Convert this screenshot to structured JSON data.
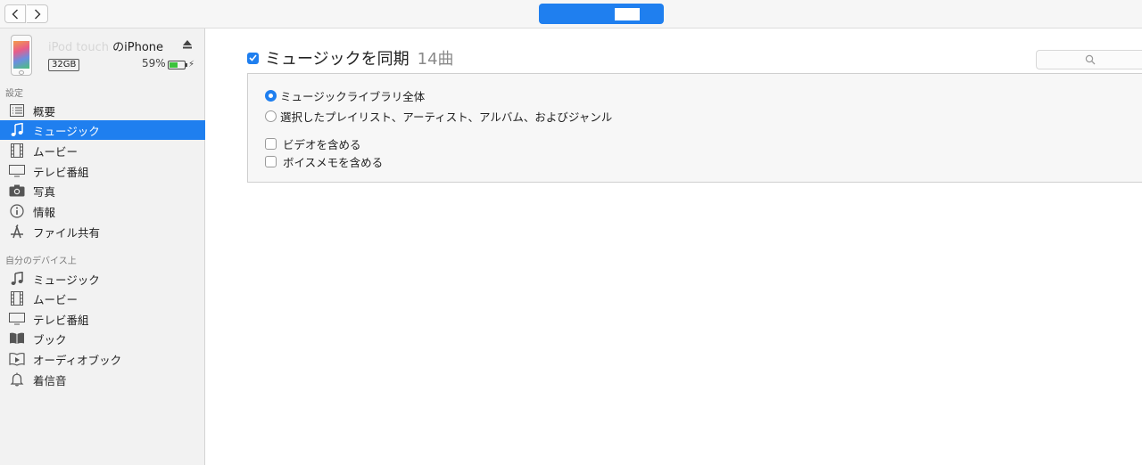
{
  "toolbar": {
    "back_icon": "chevron-left-icon",
    "forward_icon": "chevron-right-icon"
  },
  "device": {
    "name_hidden": "iPod touch ",
    "name_visible": "のiPhone",
    "capacity": "32GB",
    "battery_percent": "59%",
    "battery_level": 0.59
  },
  "sidebar": {
    "settings_title": "設定",
    "settings_items": [
      {
        "label": "概要",
        "icon": "list-icon"
      },
      {
        "label": "ミュージック",
        "icon": "music-note-icon",
        "selected": true
      },
      {
        "label": "ムービー",
        "icon": "film-icon"
      },
      {
        "label": "テレビ番組",
        "icon": "tv-icon"
      },
      {
        "label": "写真",
        "icon": "camera-icon"
      },
      {
        "label": "情報",
        "icon": "info-icon"
      },
      {
        "label": "ファイル共有",
        "icon": "apps-icon"
      }
    ],
    "ondevice_title": "自分のデバイス上",
    "ondevice_items": [
      {
        "label": "ミュージック",
        "icon": "music-note-icon"
      },
      {
        "label": "ムービー",
        "icon": "film-icon"
      },
      {
        "label": "テレビ番組",
        "icon": "tv-icon"
      },
      {
        "label": "ブック",
        "icon": "book-icon"
      },
      {
        "label": "オーディオブック",
        "icon": "audiobook-icon"
      },
      {
        "label": "着信音",
        "icon": "bell-icon"
      }
    ]
  },
  "main": {
    "sync_title": "ミュージックを同期",
    "sync_count": "14曲",
    "sync_checked": true,
    "options": {
      "entire_library": "ミュージックライブラリ全体",
      "selected_items": "選択したプレイリスト、アーティスト、アルバム、およびジャンル",
      "include_videos": "ビデオを含める",
      "include_voice_memos": "ボイスメモを含める"
    },
    "selected_option": "entire_library"
  },
  "colors": {
    "accent": "#1f7fef",
    "sidebar_bg": "#f2f2f2",
    "panel_bg": "#f7f7f7"
  }
}
